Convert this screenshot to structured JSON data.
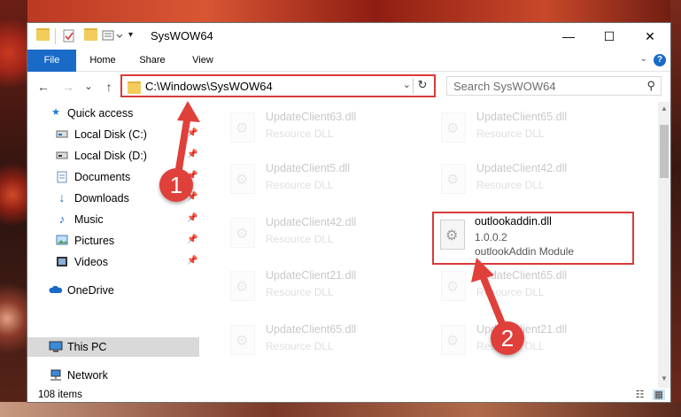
{
  "titlebar": {
    "title": "SysWOW64",
    "minimize": "—",
    "maximize": "☐",
    "close": "✕"
  },
  "ribbon": {
    "tabs": [
      "File",
      "Home",
      "Share",
      "View"
    ],
    "help": "?"
  },
  "navbar": {
    "back": "←",
    "forward": "→",
    "recent": "⌄",
    "up": "↑",
    "path": "C:\\Windows\\SysWOW64",
    "search_placeholder": "Search SysWOW64"
  },
  "nav": {
    "items": [
      {
        "label": "Quick access",
        "icon": "star-icon"
      },
      {
        "label": "Local Disk (C:)",
        "icon": "drive-icon",
        "pinned": true
      },
      {
        "label": "Local Disk (D:)",
        "icon": "drive-icon",
        "pinned": true
      },
      {
        "label": "Documents",
        "icon": "documents-icon",
        "pinned": true
      },
      {
        "label": "Downloads",
        "icon": "downloads-icon",
        "pinned": true
      },
      {
        "label": "Music",
        "icon": "music-icon",
        "pinned": true
      },
      {
        "label": "Pictures",
        "icon": "pictures-icon",
        "pinned": true
      },
      {
        "label": "Videos",
        "icon": "videos-icon",
        "pinned": true
      },
      {
        "label": "OneDrive",
        "icon": "cloud-icon"
      },
      {
        "label": "This PC",
        "icon": "computer-icon",
        "selected": true
      },
      {
        "label": "Network",
        "icon": "network-icon"
      }
    ]
  },
  "files": [
    {
      "name": "UpdateClient63.dll",
      "type": "Resource DLL"
    },
    {
      "name": "UpdateClient65.dll",
      "type": "Resource DLL"
    },
    {
      "name": "UpdateClient5.dll",
      "type": "Resource DLL"
    },
    {
      "name": "UpdateClient42.dll",
      "type": "Resource DLL"
    },
    {
      "name": "UpdateClient42.dll",
      "type": "Resource DLL"
    },
    {
      "name": "outlookaddin.dll",
      "version": "1.0.0.2",
      "type": "outlookAddin Module"
    },
    {
      "name": "UpdateClient21.dll",
      "type": "Resource DLL"
    },
    {
      "name": "UpdateClient65.dll",
      "type": "Resource DLL"
    },
    {
      "name": "UpdateClient65.dll",
      "type": "Resource DLL"
    },
    {
      "name": "UpdateClient21.dll",
      "type": "Resource DLL"
    }
  ],
  "status": {
    "item_count": "108 items"
  },
  "callouts": [
    "1",
    "2"
  ],
  "colors": {
    "accent": "#1a6ac7",
    "highlight": "#d83a3a",
    "callout": "#e0403a"
  }
}
